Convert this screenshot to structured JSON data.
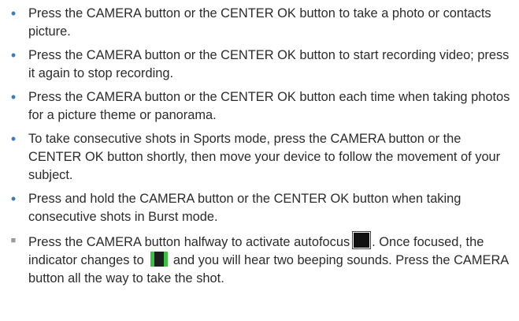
{
  "bullets": [
    {
      "marker": "dot",
      "text": "Press the CAMERA button or the CENTER OK button to take a photo or contacts picture."
    },
    {
      "marker": "dot",
      "text": "Press the CAMERA button or the CENTER OK button to start recording video; press it again to stop recording."
    },
    {
      "marker": "dot",
      "text": "Press the CAMERA button or the CENTER OK button each time when taking photos for a picture theme or panorama."
    },
    {
      "marker": "dot",
      "text": "To take consecutive shots in Sports mode, press the CAMERA button or the CENTER OK button shortly, then move your device to follow the movement of your subject."
    },
    {
      "marker": "dot",
      "text": "Press and hold the CAMERA button or the CENTER OK button when taking consecutive shots in Burst mode."
    },
    {
      "marker": "square",
      "text_part1": "Press the CAMERA button halfway to activate autofocus",
      "icon1": "autofocus-indicator-icon",
      "text_part2": ". Once focused, the indicator changes to",
      "icon2": "focused-indicator-icon",
      "text_part3": "and you will hear two beeping sounds. Press the CAMERA button all the way to take the shot."
    }
  ],
  "colors": {
    "bullet_dot": "#3a7bc0",
    "bullet_square": "#9a9a9a",
    "focused_indicator": "#39c23f"
  }
}
